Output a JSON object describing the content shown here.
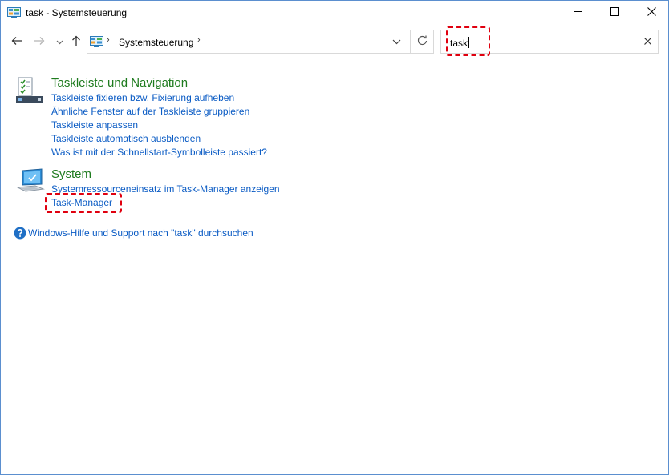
{
  "window": {
    "title": "task - Systemsteuerung",
    "icon": "control-panel-icon"
  },
  "titlebar_buttons": {
    "minimize_icon": "minimize-icon",
    "maximize_icon": "maximize-icon",
    "close_icon": "close-icon"
  },
  "nav": {
    "back_icon": "arrow-left-icon",
    "forward_icon": "arrow-right-icon",
    "recent_icon": "chevron-down-icon",
    "up_icon": "arrow-up-icon"
  },
  "address": {
    "separator": "›",
    "crumb": "Systemsteuerung",
    "trailing_separator": "›"
  },
  "search": {
    "value": "task"
  },
  "groups": [
    {
      "title": "Taskleiste und Navigation",
      "icon": "taskbar-checklist-icon",
      "links": [
        "Taskleiste fixieren bzw. Fixierung aufheben",
        "Ähnliche Fenster auf der Taskleiste gruppieren",
        "Taskleiste anpassen",
        "Taskleiste automatisch ausblenden",
        "Was ist mit der Schnellstart-Symbolleiste passiert?"
      ]
    },
    {
      "title": "System",
      "icon": "computer-monitor-icon",
      "links": [
        "Systemressourceneinsatz im Task-Manager anzeigen",
        "Task-Manager"
      ]
    }
  ],
  "help": {
    "icon": "help-question-icon",
    "text": "Windows-Hilfe und Support nach \"task\" durchsuchen"
  },
  "colors": {
    "group_title": "#1e7b1e",
    "link": "#0a5bc4",
    "highlight": "#e0000f",
    "window_border": "#5b8fcf"
  }
}
